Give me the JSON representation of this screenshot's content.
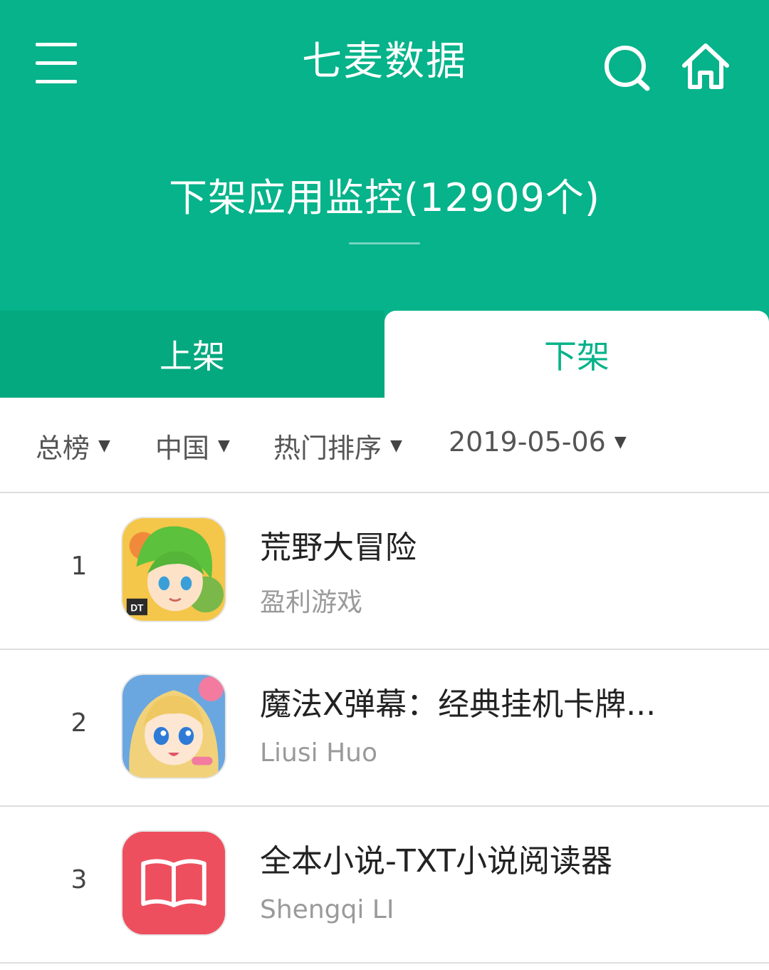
{
  "header": {
    "app_title": "七麦数据",
    "page_title": "下架应用监控(12909个)",
    "icons": [
      "menu-icon",
      "search-icon",
      "home-icon"
    ],
    "bg_color": "#06b38a"
  },
  "tabs": [
    {
      "label": "上架",
      "active": false
    },
    {
      "label": "下架",
      "active": true
    }
  ],
  "filters": [
    {
      "label": "总榜"
    },
    {
      "label": "中国"
    },
    {
      "label": "热门排序"
    },
    {
      "label": "2019-05-06"
    }
  ],
  "caret": "▼",
  "apps": [
    {
      "rank": "1",
      "name": "荒野大冒险",
      "developer": "盈利游戏",
      "icon": "game-character-green-hair-icon"
    },
    {
      "rank": "2",
      "name": "魔法X弹幕：经典挂机卡牌...",
      "developer": "Liusi Huo",
      "icon": "game-character-blonde-girl-icon"
    },
    {
      "rank": "3",
      "name": "全本小说-TXT小说阅读器",
      "developer": "Shengqi LI",
      "icon": "open-book-icon",
      "icon_color": "#ee4f5e"
    }
  ]
}
